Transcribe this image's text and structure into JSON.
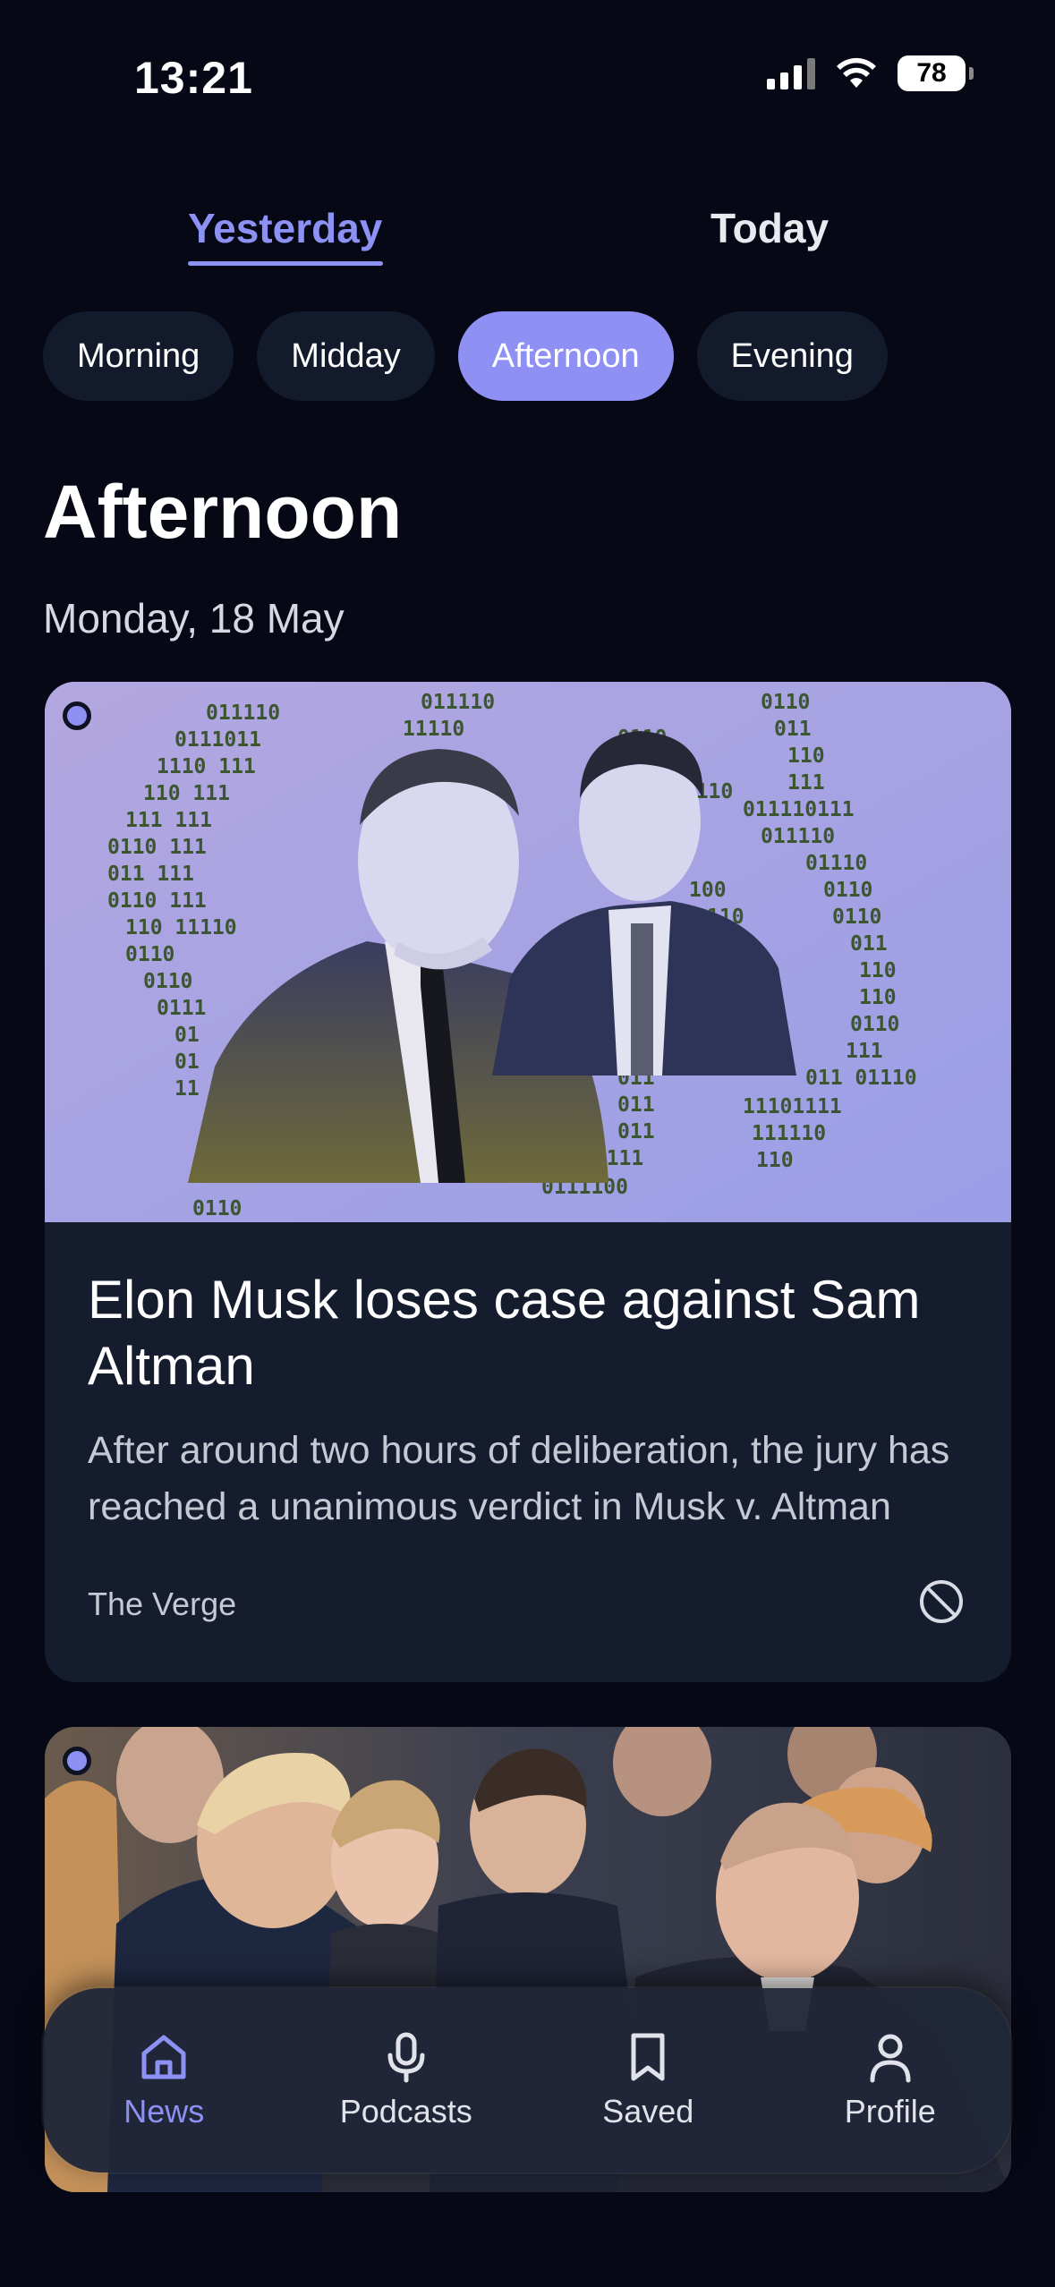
{
  "status_bar": {
    "time": "13:21",
    "battery": "78",
    "icons": [
      "signal-icon",
      "wifi-icon",
      "battery-icon"
    ]
  },
  "day_tabs": [
    {
      "label": "Yesterday",
      "active": true
    },
    {
      "label": "Today",
      "active": false
    }
  ],
  "time_filters": [
    {
      "label": "Morning",
      "selected": false
    },
    {
      "label": "Midday",
      "selected": false
    },
    {
      "label": "Afternoon",
      "selected": true
    },
    {
      "label": "Evening",
      "selected": false
    }
  ],
  "section": {
    "title": "Afternoon",
    "date": "Monday, 18 May"
  },
  "articles": [
    {
      "title": "Elon Musk loses case against Sam Altman",
      "summary": "After around two hours of deliberation, the jury has reached a unanimous verdict in Musk v. Altman",
      "source": "The Verge",
      "unread": true,
      "action_icon": "block-icon"
    },
    {
      "unread": true
    }
  ],
  "bottom_nav": [
    {
      "label": "News",
      "icon": "home-icon",
      "active": true
    },
    {
      "label": "Podcasts",
      "icon": "microphone-icon",
      "active": false
    },
    {
      "label": "Saved",
      "icon": "bookmark-icon",
      "active": false
    },
    {
      "label": "Profile",
      "icon": "person-icon",
      "active": false
    }
  ],
  "colors": {
    "accent": "#8d91f4",
    "background": "#060815",
    "card": "#151c2e"
  }
}
